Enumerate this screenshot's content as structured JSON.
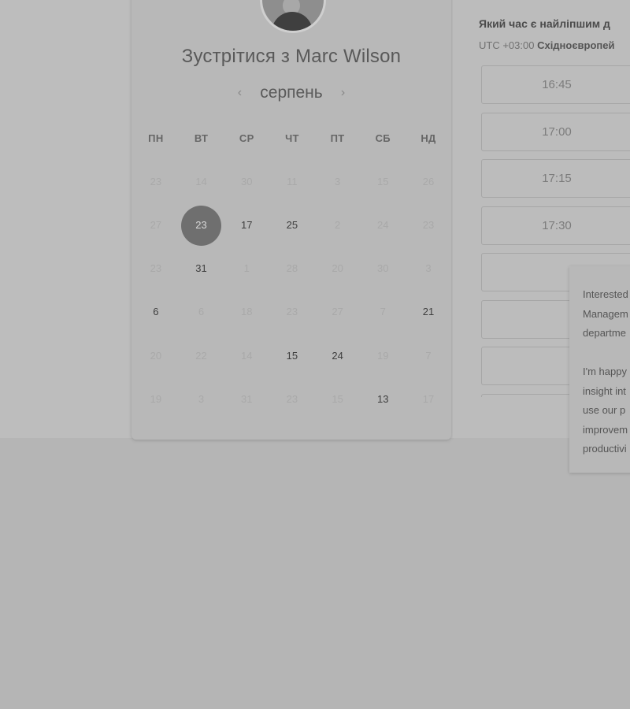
{
  "page": {
    "background": "#b5b5b5",
    "accent_selected": "#6f6f6f"
  },
  "host": {
    "title": "Зустрітися з Marc Wilson",
    "avatar_icon": "person-avatar"
  },
  "calendar": {
    "month": "серпень",
    "prev_icon": "chevron-left-icon",
    "next_icon": "chevron-right-icon",
    "weekdays": [
      "ПН",
      "ВТ",
      "СР",
      "ЧТ",
      "ПТ",
      "СБ",
      "НД"
    ],
    "weeks": [
      [
        {
          "d": "23",
          "s": "dim"
        },
        {
          "d": "14",
          "s": "dim"
        },
        {
          "d": "30",
          "s": "dim"
        },
        {
          "d": "11",
          "s": "dim"
        },
        {
          "d": "3",
          "s": "dim"
        },
        {
          "d": "15",
          "s": "dim"
        },
        {
          "d": "26",
          "s": "dim"
        }
      ],
      [
        {
          "d": "27",
          "s": "dim"
        },
        {
          "d": "23",
          "s": "selected"
        },
        {
          "d": "17",
          "s": "active"
        },
        {
          "d": "25",
          "s": "active"
        },
        {
          "d": "2",
          "s": "dim"
        },
        {
          "d": "24",
          "s": "dim"
        },
        {
          "d": "23",
          "s": "dim"
        }
      ],
      [
        {
          "d": "23",
          "s": "dim"
        },
        {
          "d": "31",
          "s": "active"
        },
        {
          "d": "1",
          "s": "dim"
        },
        {
          "d": "28",
          "s": "dim"
        },
        {
          "d": "20",
          "s": "dim"
        },
        {
          "d": "30",
          "s": "dim"
        },
        {
          "d": "3",
          "s": "dim"
        }
      ],
      [
        {
          "d": "6",
          "s": "active"
        },
        {
          "d": "6",
          "s": "dim"
        },
        {
          "d": "18",
          "s": "dim"
        },
        {
          "d": "23",
          "s": "dim"
        },
        {
          "d": "27",
          "s": "dim"
        },
        {
          "d": "7",
          "s": "dim"
        },
        {
          "d": "21",
          "s": "active"
        }
      ],
      [
        {
          "d": "20",
          "s": "dim"
        },
        {
          "d": "22",
          "s": "dim"
        },
        {
          "d": "14",
          "s": "dim"
        },
        {
          "d": "15",
          "s": "active"
        },
        {
          "d": "24",
          "s": "active"
        },
        {
          "d": "19",
          "s": "dim"
        },
        {
          "d": "7",
          "s": "dim"
        }
      ],
      [
        {
          "d": "19",
          "s": "dim"
        },
        {
          "d": "3",
          "s": "dim"
        },
        {
          "d": "31",
          "s": "dim"
        },
        {
          "d": "23",
          "s": "dim"
        },
        {
          "d": "15",
          "s": "dim"
        },
        {
          "d": "13",
          "s": "active"
        },
        {
          "d": "17",
          "s": "dim"
        }
      ]
    ]
  },
  "times": {
    "question": "Який час є найліпшим д",
    "tz_offset": "UTC +03:00",
    "tz_name": "Східноєвропей",
    "slots": [
      "16:45",
      "17:00",
      "17:15",
      "17:30",
      "",
      "",
      "",
      ""
    ]
  },
  "popup": {
    "para1": "Interested\nManagem\ndepartme",
    "para2": "I'm happy\ninsight int\nuse our p\nimprovem\nproductivi"
  }
}
